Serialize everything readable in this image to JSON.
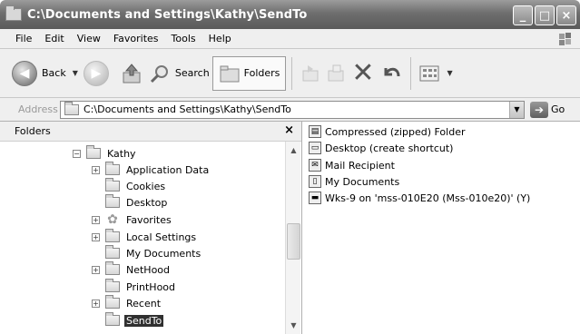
{
  "window": {
    "title": "C:\\Documents and Settings\\Kathy\\SendTo",
    "minimize": "_",
    "maximize": "□",
    "close": "×"
  },
  "menu": [
    "File",
    "Edit",
    "View",
    "Favorites",
    "Tools",
    "Help"
  ],
  "toolbar": {
    "back_label": "Back",
    "search_label": "Search",
    "folders_label": "Folders"
  },
  "address": {
    "label": "Address",
    "value": "C:\\Documents and Settings\\Kathy\\SendTo",
    "go_label": "Go"
  },
  "folders_pane": {
    "title": "Folders",
    "close": "×",
    "tree": [
      {
        "label": "Kathy",
        "expander": "−",
        "icon": "folder-icon"
      },
      {
        "label": "Application Data",
        "expander": "+",
        "icon": "folder-icon"
      },
      {
        "label": "Cookies",
        "expander": "",
        "icon": "folder-icon"
      },
      {
        "label": "Desktop",
        "expander": "",
        "icon": "folder-icon"
      },
      {
        "label": "Favorites",
        "expander": "+",
        "icon": "star-icon"
      },
      {
        "label": "Local Settings",
        "expander": "+",
        "icon": "folder-icon"
      },
      {
        "label": "My Documents",
        "expander": "",
        "icon": "folder-icon"
      },
      {
        "label": "NetHood",
        "expander": "+",
        "icon": "folder-icon"
      },
      {
        "label": "PrintHood",
        "expander": "",
        "icon": "folder-icon"
      },
      {
        "label": "Recent",
        "expander": "+",
        "icon": "folder-icon"
      },
      {
        "label": "SendTo",
        "expander": "",
        "icon": "folder-icon",
        "selected": true
      }
    ]
  },
  "files": [
    {
      "label": "Compressed (zipped) Folder",
      "icon": "zip-folder-icon"
    },
    {
      "label": "Desktop (create shortcut)",
      "icon": "desktop-icon"
    },
    {
      "label": "Mail Recipient",
      "icon": "mail-icon"
    },
    {
      "label": "My Documents",
      "icon": "my-documents-icon"
    },
    {
      "label": "Wks-9 on 'mss-010E20 (Mss-010e20)' (Y)",
      "icon": "network-drive-icon"
    }
  ]
}
